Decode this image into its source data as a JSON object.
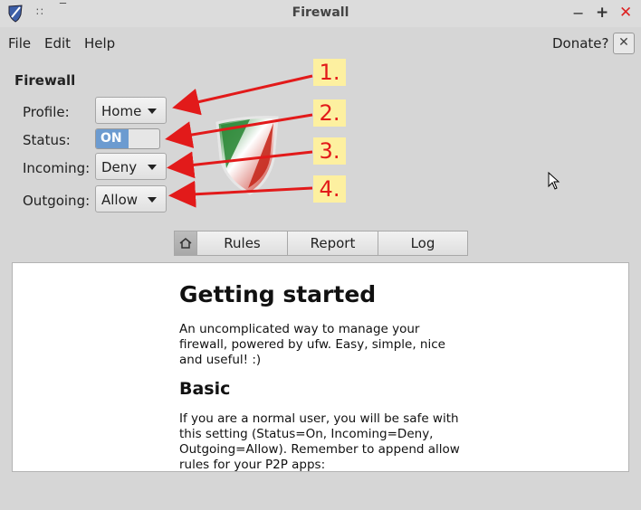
{
  "window": {
    "title": "Firewall"
  },
  "menubar": {
    "file": "File",
    "edit": "Edit",
    "help": "Help",
    "donate": "Donate?"
  },
  "section_title": "Firewall",
  "settings": {
    "profile_label": "Profile:",
    "profile_value": "Home",
    "status_label": "Status:",
    "status_value": "ON",
    "incoming_label": "Incoming:",
    "incoming_value": "Deny",
    "outgoing_label": "Outgoing:",
    "outgoing_value": "Allow"
  },
  "annotations": [
    "1.",
    "2.",
    "3.",
    "4."
  ],
  "annotation_color": "#e21a1a",
  "tabs": [
    "Rules",
    "Report",
    "Log"
  ],
  "content": {
    "heading": "Getting started",
    "intro": "An uncomplicated way to manage your firewall, powered by ufw. Easy, simple, nice and useful! :)",
    "subheading": "Basic",
    "basic_text": "If you are a normal user, you will be safe with this setting (Status=On, Incoming=Deny, Outgoing=Allow). Remember to append allow rules for your P2P apps:"
  },
  "icons": [
    "app-shield-icon",
    "minimize-icon",
    "maximize-icon",
    "close-icon",
    "home-icon",
    "mouse-cursor-icon",
    "caret-down-icon"
  ]
}
